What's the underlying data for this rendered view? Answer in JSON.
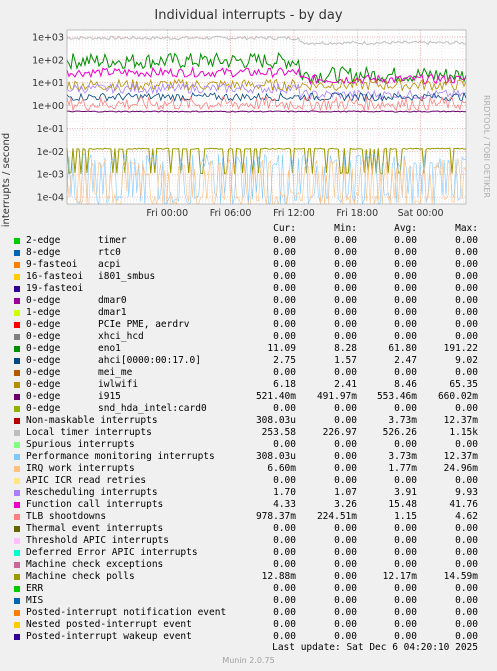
{
  "title": "Individual interrupts - by day",
  "ylabel": "interrupts / second",
  "watermark": "RRDTOOL / TOBI OETIKER",
  "footer": "Munin 2.0.75",
  "last_update": "Last update: Sat Dec  6 04:20:10 2025",
  "legend_headers": {
    "cur": "Cur:",
    "min": "Min:",
    "avg": "Avg:",
    "max": "Max:"
  },
  "chart_data": {
    "type": "line",
    "y_scale": "log",
    "ylim": [
      5e-05,
      2000
    ],
    "y_ticks": [
      "1e+03",
      "1e+02",
      "1e+01",
      "1e+00",
      "1e-01",
      "1e-02",
      "1e-03",
      "1e-04"
    ],
    "x_ticks": [
      "Fri 00:00",
      "Fri 06:00",
      "Fri 12:00",
      "Fri 18:00",
      "Sat 00:00"
    ],
    "x_range_hours": [
      -9.5,
      28.3
    ],
    "grid": true,
    "series": [
      {
        "name": "2-edge timer",
        "color": "#00cc00",
        "cur": "0.00",
        "min": "0.00",
        "avg": "0.00",
        "max": "0.00"
      },
      {
        "name": "8-edge rtc0",
        "color": "#0066b3",
        "cur": "0.00",
        "min": "0.00",
        "avg": "0.00",
        "max": "0.00"
      },
      {
        "name": "9-fasteoi acpi",
        "color": "#ff8000",
        "cur": "0.00",
        "min": "0.00",
        "avg": "0.00",
        "max": "0.00"
      },
      {
        "name": "16-fasteoi i801_smbus",
        "color": "#ffcc00",
        "cur": "0.00",
        "min": "0.00",
        "avg": "0.00",
        "max": "0.00"
      },
      {
        "name": "19-fasteoi",
        "color": "#330099",
        "cur": "0.00",
        "min": "0.00",
        "avg": "0.00",
        "max": "0.00"
      },
      {
        "name": "0-edge dmar0",
        "color": "#990099",
        "cur": "0.00",
        "min": "0.00",
        "avg": "0.00",
        "max": "0.00"
      },
      {
        "name": "1-edge dmar1",
        "color": "#ccff00",
        "cur": "0.00",
        "min": "0.00",
        "avg": "0.00",
        "max": "0.00"
      },
      {
        "name": "0-edge PCIe PME, aerdrv",
        "color": "#ff0000",
        "cur": "0.00",
        "min": "0.00",
        "avg": "0.00",
        "max": "0.00"
      },
      {
        "name": "0-edge xhci_hcd",
        "color": "#808080",
        "cur": "0.00",
        "min": "0.00",
        "avg": "0.00",
        "max": "0.00"
      },
      {
        "name": "0-edge eno1",
        "color": "#008f00",
        "cur": "11.09",
        "min": "8.28",
        "avg": "61.80",
        "max": "191.22"
      },
      {
        "name": "0-edge ahci[0000:00:17.0]",
        "color": "#00487d",
        "cur": "2.75",
        "min": "1.57",
        "avg": "2.47",
        "max": "9.02"
      },
      {
        "name": "0-edge mei_me",
        "color": "#b35a00",
        "cur": "0.00",
        "min": "0.00",
        "avg": "0.00",
        "max": "0.00"
      },
      {
        "name": "0-edge iwlwifi",
        "color": "#b38f00",
        "cur": "6.18",
        "min": "2.41",
        "avg": "8.46",
        "max": "65.35"
      },
      {
        "name": "0-edge i915",
        "color": "#6b006b",
        "cur": "521.40m",
        "min": "491.97m",
        "avg": "553.46m",
        "max": "660.02m"
      },
      {
        "name": "0-edge snd_hda_intel:card0",
        "color": "#8fb300",
        "cur": "0.00",
        "min": "0.00",
        "avg": "0.00",
        "max": "0.00"
      },
      {
        "name": "Non-maskable interrupts",
        "color": "#b30000",
        "cur": "308.03u",
        "min": "0.00",
        "avg": "3.73m",
        "max": "12.37m"
      },
      {
        "name": "Local timer interrupts",
        "color": "#bebebe",
        "cur": "253.58",
        "min": "226.97",
        "avg": "526.26",
        "max": "1.15k"
      },
      {
        "name": "Spurious interrupts",
        "color": "#80ff80",
        "cur": "0.00",
        "min": "0.00",
        "avg": "0.00",
        "max": "0.00"
      },
      {
        "name": "Performance monitoring interrupts",
        "color": "#80c9ff",
        "cur": "308.03u",
        "min": "0.00",
        "avg": "3.73m",
        "max": "12.37m"
      },
      {
        "name": "IRQ work interrupts",
        "color": "#ffc080",
        "cur": "6.60m",
        "min": "0.00",
        "avg": "1.77m",
        "max": "24.96m"
      },
      {
        "name": "APIC ICR read retries",
        "color": "#ffe680",
        "cur": "0.00",
        "min": "0.00",
        "avg": "0.00",
        "max": "0.00"
      },
      {
        "name": "Rescheduling interrupts",
        "color": "#aa80ff",
        "cur": "1.70",
        "min": "1.07",
        "avg": "3.91",
        "max": "9.93"
      },
      {
        "name": "Function call interrupts",
        "color": "#ee00cc",
        "cur": "4.33",
        "min": "3.26",
        "avg": "15.48",
        "max": "41.76"
      },
      {
        "name": "TLB shootdowns",
        "color": "#ff8080",
        "cur": "978.37m",
        "min": "224.51m",
        "avg": "1.15",
        "max": "4.62"
      },
      {
        "name": "Thermal event interrupts",
        "color": "#666600",
        "cur": "0.00",
        "min": "0.00",
        "avg": "0.00",
        "max": "0.00"
      },
      {
        "name": "Threshold APIC interrupts",
        "color": "#ffbfff",
        "cur": "0.00",
        "min": "0.00",
        "avg": "0.00",
        "max": "0.00"
      },
      {
        "name": "Deferred Error APIC interrupts",
        "color": "#00ffcc",
        "cur": "0.00",
        "min": "0.00",
        "avg": "0.00",
        "max": "0.00"
      },
      {
        "name": "Machine check exceptions",
        "color": "#cc6699",
        "cur": "0.00",
        "min": "0.00",
        "avg": "0.00",
        "max": "0.00"
      },
      {
        "name": "Machine check polls",
        "color": "#999900",
        "cur": "12.88m",
        "min": "0.00",
        "avg": "12.17m",
        "max": "14.59m"
      },
      {
        "name": "ERR",
        "color": "#00cc00",
        "cur": "0.00",
        "min": "0.00",
        "avg": "0.00",
        "max": "0.00"
      },
      {
        "name": "MIS",
        "color": "#0066b3",
        "cur": "0.00",
        "min": "0.00",
        "avg": "0.00",
        "max": "0.00"
      },
      {
        "name": "Posted-interrupt notification event",
        "color": "#ff8000",
        "cur": "0.00",
        "min": "0.00",
        "avg": "0.00",
        "max": "0.00"
      },
      {
        "name": "Nested posted-interrupt event",
        "color": "#ffcc00",
        "cur": "0.00",
        "min": "0.00",
        "avg": "0.00",
        "max": "0.00"
      },
      {
        "name": "Posted-interrupt wakeup event",
        "color": "#330099",
        "cur": "0.00",
        "min": "0.00",
        "avg": "0.00",
        "max": "0.00"
      }
    ]
  }
}
